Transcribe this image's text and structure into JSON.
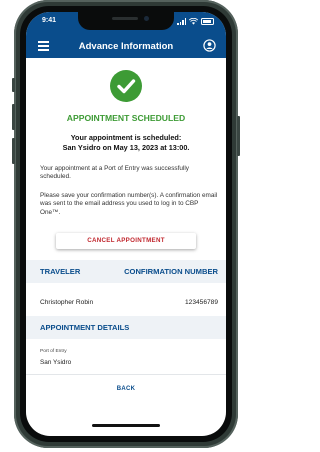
{
  "status_bar": {
    "time": "9:41"
  },
  "header": {
    "title": "Advance Information",
    "menu_icon": "menu-icon",
    "account_icon": "user-circle-icon"
  },
  "confirmation": {
    "icon": "check-circle-icon",
    "title": "APPOINTMENT SCHEDULED",
    "line1": "Your appointment is scheduled:",
    "line2": "San Ysidro on May 13, 2023 at 13:00.",
    "para1": "Your appointment at a Port of Entry was successfully scheduled.",
    "para2": "Please save your confirmation number(s). A confirmation email was sent to the email address you used to log in to CBP One™."
  },
  "cancel_button": {
    "label": "CANCEL APPOINTMENT"
  },
  "traveler_table": {
    "headers": [
      "TRAVELER",
      "CONFIRMATION NUMBER"
    ],
    "rows": [
      {
        "name": "Christopher Robin",
        "number": "123456789"
      }
    ]
  },
  "appointment_details": {
    "heading": "APPOINTMENT DETAILS",
    "port_label": "Port of Entry",
    "port_value": "San Ysidro"
  },
  "back_button": {
    "label": "BACK"
  },
  "colors": {
    "brand_blue": "#0a4d8c",
    "success_green": "#3d9b35",
    "danger_red": "#c0262d",
    "section_bg": "#eef2f6"
  }
}
